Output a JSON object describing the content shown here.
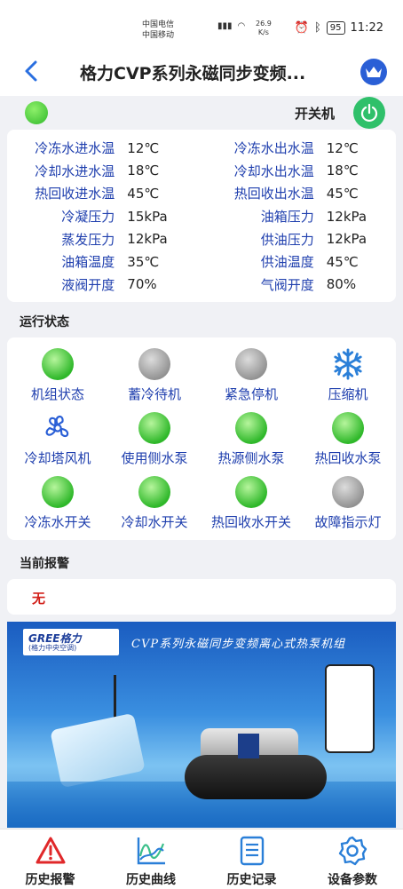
{
  "status_bar": {
    "carrier1": "中国电信",
    "carrier2": "中国移动",
    "net_speed": "26.9",
    "net_unit": "K/s",
    "battery": "95",
    "time": "11:22"
  },
  "nav": {
    "title": "格力CVP系列永磁同步变频..."
  },
  "power": {
    "label": "开关机"
  },
  "params": [
    {
      "l1": "冷冻水进水温",
      "v1": "12℃",
      "l2": "冷冻水出水温",
      "v2": "12℃"
    },
    {
      "l1": "冷却水进水温",
      "v1": "18℃",
      "l2": "冷却水出水温",
      "v2": "18℃"
    },
    {
      "l1": "热回收进水温",
      "v1": "45℃",
      "l2": "热回收出水温",
      "v2": "45℃"
    },
    {
      "l1": "冷凝压力",
      "v1": "15kPa",
      "l2": "油箱压力",
      "v2": "12kPa"
    },
    {
      "l1": "蒸发压力",
      "v1": "12kPa",
      "l2": "供油压力",
      "v2": "12kPa"
    },
    {
      "l1": "油箱温度",
      "v1": "35℃",
      "l2": "供油温度",
      "v2": "45℃"
    },
    {
      "l1": "液阀开度",
      "v1": "70%",
      "l2": "气阀开度",
      "v2": "80%"
    }
  ],
  "running_status": {
    "title": "运行状态",
    "items": [
      {
        "label": "机组状态",
        "state": "on",
        "icon": "green-indicator"
      },
      {
        "label": "蓄冷待机",
        "state": "off",
        "icon": "gray-indicator"
      },
      {
        "label": "紧急停机",
        "state": "off",
        "icon": "gray-indicator"
      },
      {
        "label": "压缩机",
        "state": "on",
        "icon": "snowflake-icon"
      },
      {
        "label": "冷却塔风机",
        "state": "on",
        "icon": "fan-icon"
      },
      {
        "label": "使用侧水泵",
        "state": "on",
        "icon": "green-indicator"
      },
      {
        "label": "热源侧水泵",
        "state": "on",
        "icon": "green-indicator"
      },
      {
        "label": "热回收水泵",
        "state": "on",
        "icon": "green-indicator"
      },
      {
        "label": "冷冻水开关",
        "state": "on",
        "icon": "green-indicator"
      },
      {
        "label": "冷却水开关",
        "state": "on",
        "icon": "green-indicator"
      },
      {
        "label": "热回收水开关",
        "state": "on",
        "icon": "green-indicator"
      },
      {
        "label": "故障指示灯",
        "state": "off",
        "icon": "gray-indicator"
      }
    ]
  },
  "alarm": {
    "title": "当前报警",
    "value": "无"
  },
  "banner": {
    "logo_top": "GREE格力",
    "logo_bottom": "(格力中央空调)",
    "headline": "CVP系列永磁同步变频离心式热泵机组"
  },
  "tabs": [
    {
      "label": "历史报警",
      "icon": "warning-icon"
    },
    {
      "label": "历史曲线",
      "icon": "chart-line-icon"
    },
    {
      "label": "历史记录",
      "icon": "document-icon"
    },
    {
      "label": "设备参数",
      "icon": "gear-icon"
    }
  ],
  "colors": {
    "accent_blue": "#1f3fae",
    "power_green": "#2fc06a",
    "alarm_red": "#d2201a",
    "tab_blue": "#2a7fd8"
  }
}
